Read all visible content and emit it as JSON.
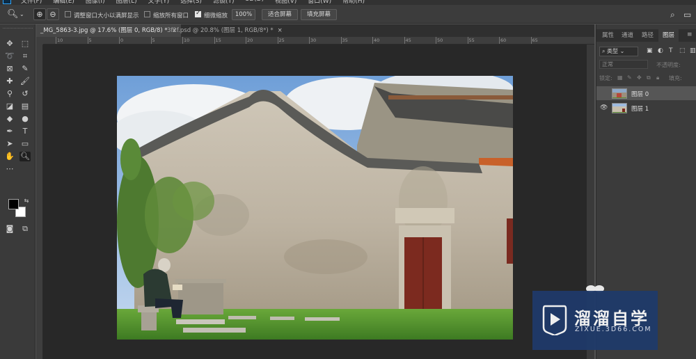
{
  "menubar": {
    "items": [
      "文件(F)",
      "编辑(E)",
      "图像(I)",
      "图层(L)",
      "文字(Y)",
      "选择(S)",
      "滤镜(T)",
      "3D(D)",
      "视图(V)",
      "窗口(W)",
      "帮助(H)"
    ]
  },
  "options_bar": {
    "tool_icon": "zoom-icon",
    "resize_windows_label": "调整窗口大小以满屏显示",
    "zoom_all_windows_label": "缩放所有窗口",
    "scrubby_zoom_label": "细微缩放",
    "zoom_value": "100%",
    "fit_screen_label": "适合屏幕",
    "fill_screen_label": "填充屏幕",
    "scrubby_zoom_checked": true,
    "resize_windows_checked": false,
    "zoom_all_windows_checked": false
  },
  "tabs": [
    {
      "title": "_MG_5863-3.jpg @ 17.6% (图层 0, RGB/8) *",
      "active": true
    },
    {
      "title": "3f2f.psd @ 20.8% (图层 1, RGB/8*) *",
      "active": false
    }
  ],
  "ruler": {
    "labels": [
      "10",
      "5",
      "0",
      "5",
      "10",
      "15",
      "20",
      "25",
      "30",
      "35",
      "40",
      "45",
      "50",
      "55",
      "60",
      "65"
    ]
  },
  "layers_panel": {
    "tabs": [
      "属性",
      "通道",
      "路径",
      "图层"
    ],
    "active_tab": "图层",
    "filter_label": "类型",
    "blend_mode": "正常",
    "opacity_label": "不透明度:",
    "lock_label": "锁定:",
    "fill_label": "填充:",
    "layers": [
      {
        "name": "图层 0",
        "visible": false,
        "selected": true
      },
      {
        "name": "图层 1",
        "visible": true,
        "selected": false
      }
    ]
  },
  "watermark": {
    "title": "溜溜自学",
    "subtitle": "ZIXUE.3D66.COM"
  },
  "colors": {
    "accent": "#31a8ff",
    "panel_bg": "#3b3b3b",
    "canvas_bg": "#282828",
    "watermark_bg": "#1f3a6b"
  }
}
